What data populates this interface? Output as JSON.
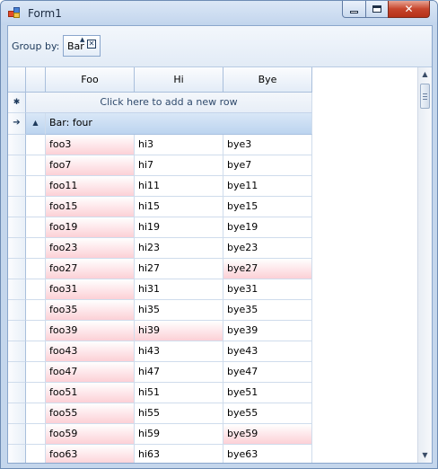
{
  "window": {
    "title": "Form1",
    "minimize_label": "",
    "maximize_label": "",
    "close_glyph": "✕"
  },
  "groupbar": {
    "label": "Group by:",
    "chip_label": "Bar",
    "chip_close": "✕",
    "chip_sort": "▲"
  },
  "grid": {
    "columns": [
      "Foo",
      "Hi",
      "Bye"
    ],
    "new_row_text": "Click here to add a new row",
    "new_row_marker": "✱",
    "group_row_text": "Bar: four",
    "group_expand_glyph": "▲",
    "current_row_glyph": "➔",
    "rows": [
      {
        "foo": "foo3",
        "hi": "hi3",
        "bye": "bye3",
        "foo_hl": true,
        "hi_hl": false,
        "bye_hl": false
      },
      {
        "foo": "foo7",
        "hi": "hi7",
        "bye": "bye7",
        "foo_hl": true,
        "hi_hl": false,
        "bye_hl": false
      },
      {
        "foo": "foo11",
        "hi": "hi11",
        "bye": "bye11",
        "foo_hl": true,
        "hi_hl": false,
        "bye_hl": false
      },
      {
        "foo": "foo15",
        "hi": "hi15",
        "bye": "bye15",
        "foo_hl": true,
        "hi_hl": false,
        "bye_hl": false
      },
      {
        "foo": "foo19",
        "hi": "hi19",
        "bye": "bye19",
        "foo_hl": true,
        "hi_hl": false,
        "bye_hl": false
      },
      {
        "foo": "foo23",
        "hi": "hi23",
        "bye": "bye23",
        "foo_hl": true,
        "hi_hl": false,
        "bye_hl": false
      },
      {
        "foo": "foo27",
        "hi": "hi27",
        "bye": "bye27",
        "foo_hl": true,
        "hi_hl": false,
        "bye_hl": true
      },
      {
        "foo": "foo31",
        "hi": "hi31",
        "bye": "bye31",
        "foo_hl": true,
        "hi_hl": false,
        "bye_hl": false
      },
      {
        "foo": "foo35",
        "hi": "hi35",
        "bye": "bye35",
        "foo_hl": true,
        "hi_hl": false,
        "bye_hl": false
      },
      {
        "foo": "foo39",
        "hi": "hi39",
        "bye": "bye39",
        "foo_hl": true,
        "hi_hl": true,
        "bye_hl": false
      },
      {
        "foo": "foo43",
        "hi": "hi43",
        "bye": "bye43",
        "foo_hl": true,
        "hi_hl": false,
        "bye_hl": false
      },
      {
        "foo": "foo47",
        "hi": "hi47",
        "bye": "bye47",
        "foo_hl": true,
        "hi_hl": false,
        "bye_hl": false
      },
      {
        "foo": "foo51",
        "hi": "hi51",
        "bye": "bye51",
        "foo_hl": true,
        "hi_hl": false,
        "bye_hl": false
      },
      {
        "foo": "foo55",
        "hi": "hi55",
        "bye": "bye55",
        "foo_hl": true,
        "hi_hl": false,
        "bye_hl": false
      },
      {
        "foo": "foo59",
        "hi": "hi59",
        "bye": "bye59",
        "foo_hl": true,
        "hi_hl": false,
        "bye_hl": true
      },
      {
        "foo": "foo63",
        "hi": "hi63",
        "bye": "bye63",
        "foo_hl": true,
        "hi_hl": false,
        "bye_hl": false
      }
    ]
  },
  "scrollbar": {
    "up_glyph": "▲",
    "down_glyph": "▼"
  },
  "colors": {
    "highlight": "#fcd0d6",
    "header": "#e3ecf7",
    "group_row": "#bcd4ef",
    "close_button": "#c6452c"
  }
}
